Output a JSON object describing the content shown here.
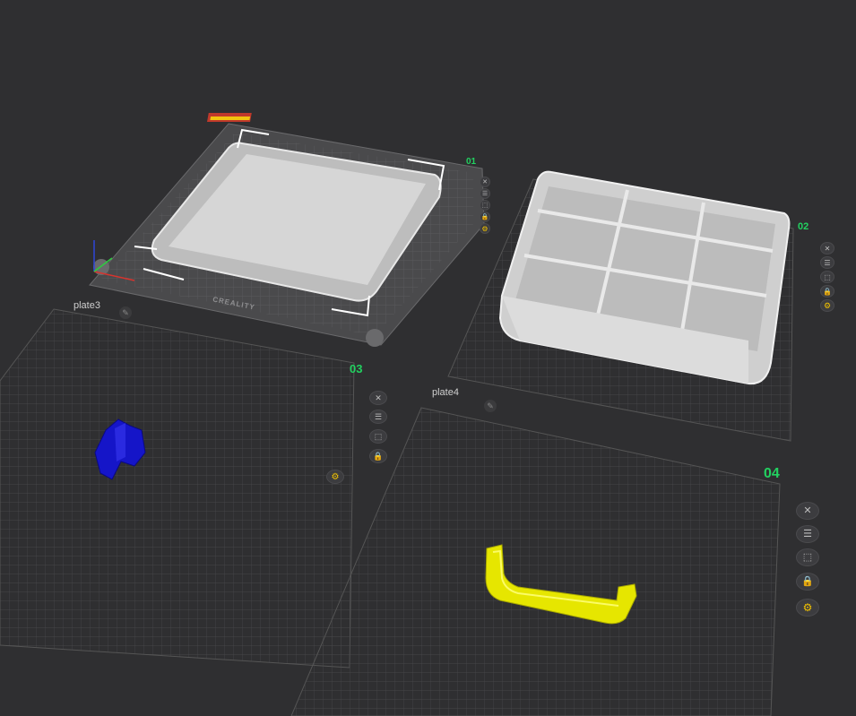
{
  "plates": [
    {
      "index": "01",
      "name": ""
    },
    {
      "index": "02",
      "name": ""
    },
    {
      "index": "03",
      "name": "plate3"
    },
    {
      "index": "04",
      "name": "plate4"
    }
  ],
  "bed_brand": "CREALITY",
  "plate_buttons": [
    {
      "icon": "close-icon",
      "glyph": "✕"
    },
    {
      "icon": "arrange-icon",
      "glyph": "☰"
    },
    {
      "icon": "orient-icon",
      "glyph": "⬚"
    },
    {
      "icon": "lock-icon",
      "glyph": "🔒"
    },
    {
      "icon": "settings-gear-icon",
      "glyph": "⚙"
    }
  ],
  "colors": {
    "background": "#2f2f31",
    "plate_index": "#22d160",
    "model_blue": "#1515c8",
    "model_yellow": "#e6e600",
    "model_gray": "#d9d9d9",
    "gear_icon": "#f2c200"
  }
}
